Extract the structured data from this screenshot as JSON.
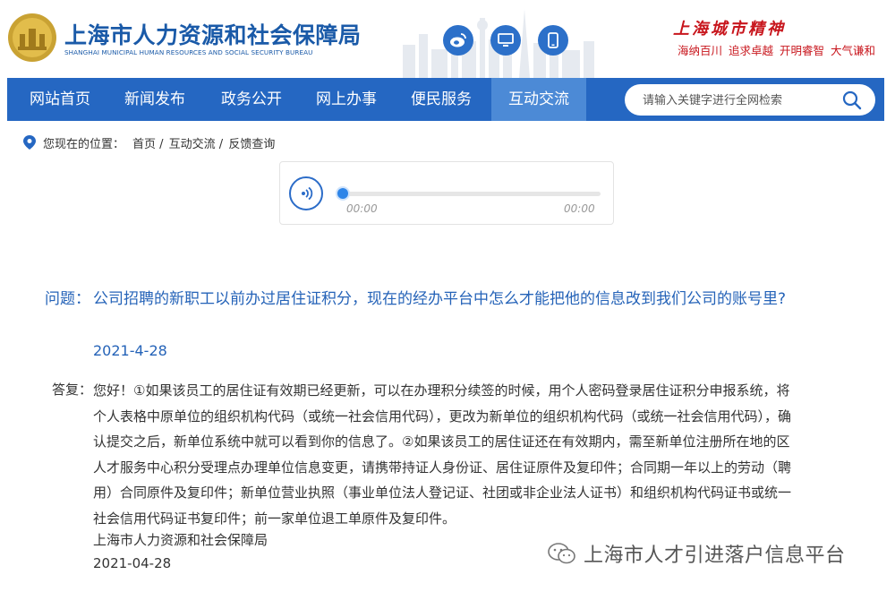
{
  "header": {
    "org_name_cn": "上海市人力资源和社会保障局",
    "org_name_en": "SHANGHAI MUNICIPAL HUMAN RESOURCES AND SOCIAL SECURITY BUREAU",
    "city_spirit_title": "上海城市精神",
    "city_spirit_slogans": [
      "海纳百川",
      "追求卓越",
      "开明睿智",
      "大气谦和"
    ],
    "icons": [
      "weibo-icon",
      "desktop-icon",
      "mobile-icon"
    ]
  },
  "nav": {
    "items": [
      "网站首页",
      "新闻发布",
      "政务公开",
      "网上办事",
      "便民服务",
      "互动交流"
    ],
    "active": "互动交流",
    "search_placeholder": "请输入关键字进行全网检索"
  },
  "breadcrumb": {
    "label": "您现在的位置：",
    "items": [
      "首页 /",
      "互动交流 /",
      "反馈查询"
    ]
  },
  "player": {
    "current_time": "00:00",
    "total_time": "00:00",
    "progress": 0
  },
  "qa": {
    "question_label": "问题：",
    "question": "公司招聘的新职工以前办过居住证积分，现在的经办平台中怎么才能把他的信息改到我们公司的账号里?",
    "question_date": "2021-4-28",
    "answer_label": "答复：",
    "answer": "您好！①如果该员工的居住证有效期已经更新，可以在办理积分续签的时候，用个人密码登录居住证积分申报系统，将个人表格中原单位的组织机构代码（或统一社会信用代码），更改为新单位的组织机构代码（或统一社会信用代码），确认提交之后，新单位系统中就可以看到你的信息了。②如果该员工的居住证还在有效期内，需至新单位注册所在地的区人才服务中心积分受理点办理单位信息变更，请携带持证人身份证、居住证原件及复印件；合同期一年以上的劳动（聘用）合同原件及复印件；新单位营业执照（事业单位法人登记证、社团或非企业法人证书）和组织机构代码证书或统一社会信用代码证书复印件；前一家单位退工单原件及复印件。",
    "answer_org": "上海市人力资源和社会保障局",
    "answer_date": "2021-04-28"
  },
  "watermark": {
    "text": "上海市人才引进落户信息平台"
  },
  "colors": {
    "nav_bg": "#2567c2",
    "nav_active": "#4c8ad6",
    "question": "#2563b8",
    "slogan": "#c8161d"
  }
}
